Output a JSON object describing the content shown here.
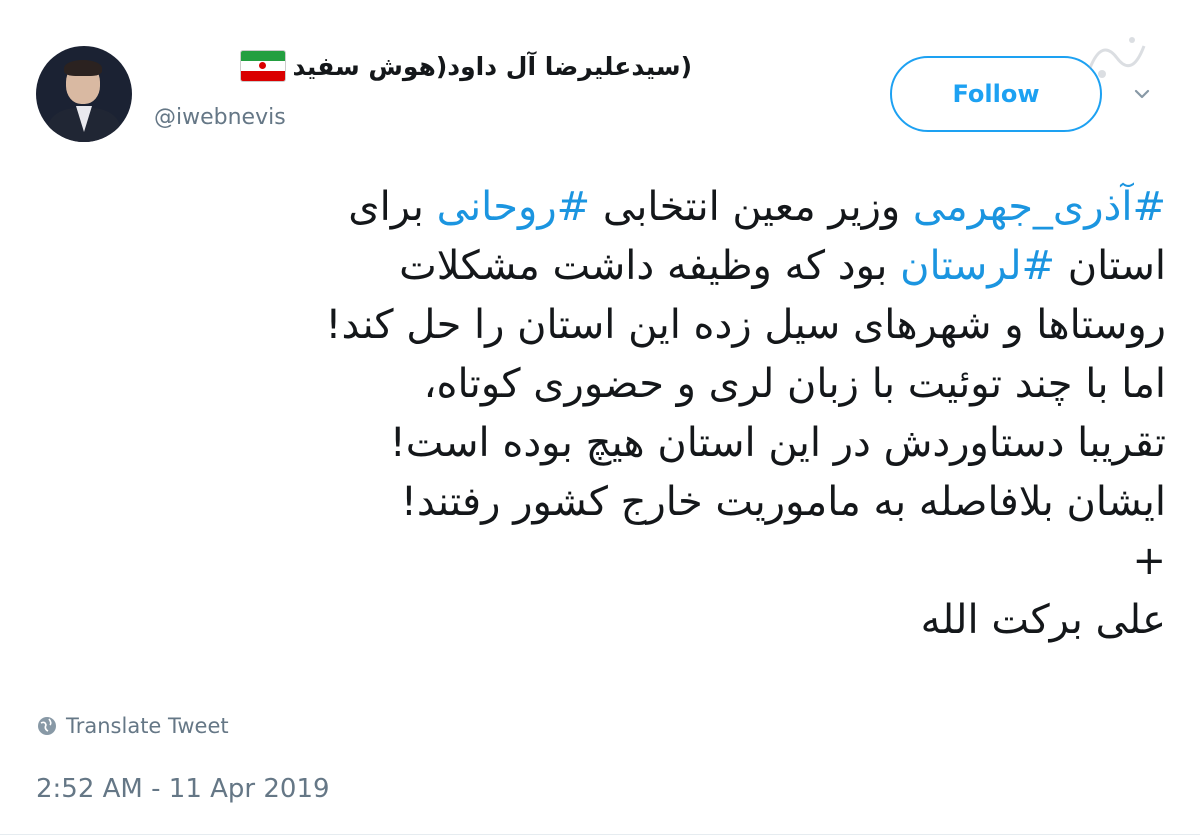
{
  "user": {
    "display_name": "(سیدعلیرضا آل داود(هوش سفید",
    "handle": "@iwebnevis"
  },
  "follow_button": {
    "label": "Follow"
  },
  "tweet": {
    "lines": [
      [
        {
          "text": "#آذری_جهرمی",
          "hashtag": true
        },
        {
          "text": " وزیر معین انتخابی "
        },
        {
          "text": "#روحانی",
          "hashtag": true
        },
        {
          "text": " برای"
        }
      ],
      [
        {
          "text": "استان "
        },
        {
          "text": "#لرستان",
          "hashtag": true
        },
        {
          "text": " بود که وظیفه داشت مشکلات"
        }
      ],
      [
        {
          "text": "روستاها و شهرهای سیل زده این استان را حل کند!"
        }
      ],
      [
        {
          "text": "اما با چند توئیت با زبان لری و حضوری کوتاه،"
        }
      ],
      [
        {
          "text": "تقریبا دستاوردش در این استان هیچ بوده است!"
        }
      ],
      [
        {
          "text": "ایشان بلافاصله به ماموریت خارج کشور رفتند!"
        }
      ],
      [
        {
          "text": "+"
        }
      ],
      [
        {
          "text": "علی برکت الله"
        }
      ]
    ]
  },
  "translate_label": "Translate Tweet",
  "timestamp": "2:52 AM - 11 Apr 2019",
  "colors": {
    "accent": "#1da1f2",
    "hashtag": "#1b95e0",
    "muted": "#657786"
  },
  "icons": [
    "avatar",
    "iran-flag-icon",
    "chevron-down-icon",
    "globe-icon"
  ]
}
